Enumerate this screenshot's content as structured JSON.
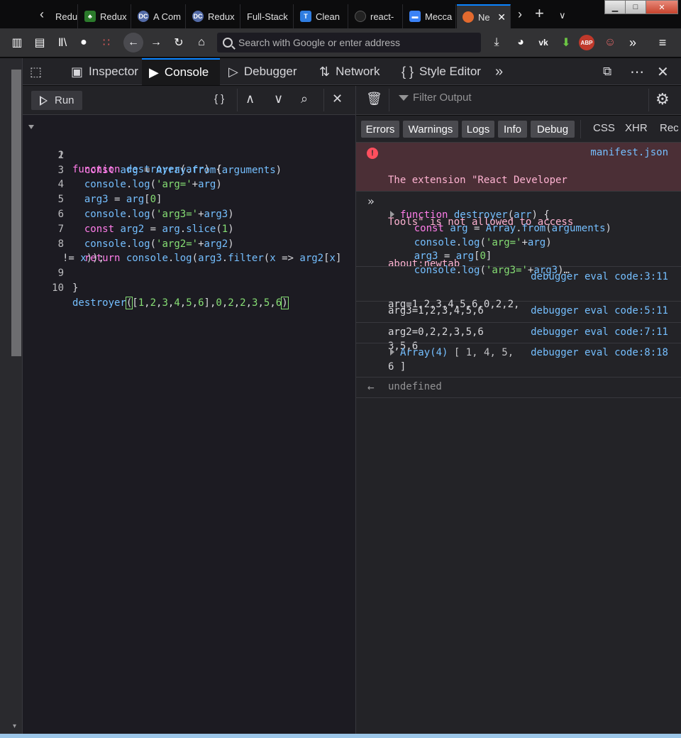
{
  "browser": {
    "tabs": [
      {
        "label": "Redu",
        "fav": "",
        "favColor": "#5a5a5a"
      },
      {
        "label": "Redux",
        "fav": "🐸",
        "favColor": "#2b7a2b"
      },
      {
        "label": "A Com",
        "fav": "DC",
        "favColor": "#536ba8"
      },
      {
        "label": "Redux",
        "fav": "DC",
        "favColor": "#536ba8"
      },
      {
        "label": "Full-Stack",
        "fav": "",
        "favColor": "#0c0c0d"
      },
      {
        "label": "Clean",
        "fav": "T",
        "favColor": "#2f7de1"
      },
      {
        "label": "react-",
        "fav": "",
        "favColor": "#222"
      },
      {
        "label": "Mecca",
        "fav": "▬",
        "favColor": "#3b82f6"
      },
      {
        "label": "Ne",
        "fav": "",
        "favColor": "#e36a2e"
      }
    ],
    "search_placeholder": "Search with Google or enter address"
  },
  "devtools": {
    "tools": [
      "Inspector",
      "Console",
      "Debugger",
      "Network",
      "Style Editor"
    ],
    "selected_tool": "Console"
  },
  "editor": {
    "run_label": "Run",
    "pretty_print": "{ }",
    "lines": [
      "1",
      "2",
      "3",
      "4",
      "5",
      "6",
      "7",
      "8",
      "",
      "9",
      "10"
    ]
  },
  "console": {
    "filter_placeholder": "Filter Output",
    "filters": [
      "Errors",
      "Warnings",
      "Logs",
      "Info",
      "Debug"
    ],
    "req_filters": [
      "CSS",
      "XHR",
      "Rec"
    ],
    "error_message": [
      "The extension \"React Developer",
      "Tools\" is not allowed to access",
      "about:newtab"
    ],
    "error_source": "manifest.json",
    "log1": [
      "arg=1,2,3,4,5,6,0,2,2,",
      "3,5,6"
    ],
    "log1_src": "debugger eval code:3:11",
    "log2": "arg3=1,2,3,4,5,6",
    "log2_src": "debugger eval code:5:11",
    "log3": "arg2=0,2,2,3,5,6",
    "log3_src": "debugger eval code:7:11",
    "array_label": "Array(4)",
    "array_values": [
      "[ 1, 4, 5,",
      "6 ]"
    ],
    "log4_src": "debugger eval code:8:18",
    "result": "undefined"
  }
}
